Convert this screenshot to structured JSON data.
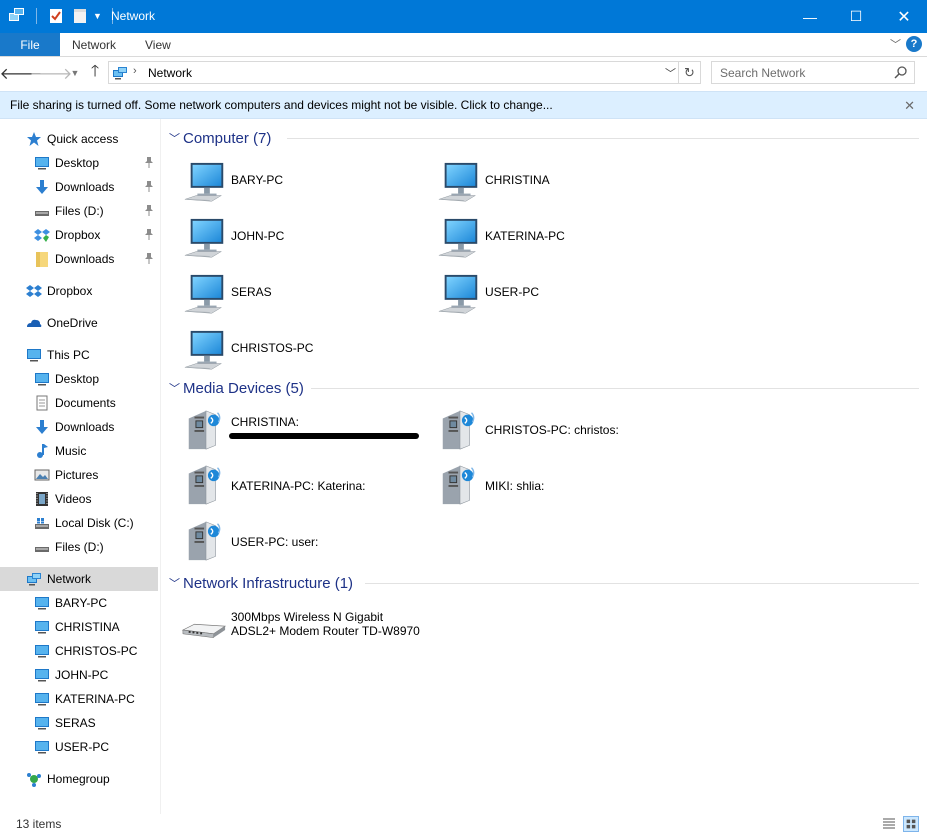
{
  "window": {
    "title": "Network",
    "accent": "#0078d7"
  },
  "ribbon": {
    "tabs": [
      "File",
      "Network",
      "View"
    ],
    "help_icon": "?"
  },
  "address": {
    "location": "Network",
    "search_placeholder": "Search Network"
  },
  "infobar": {
    "message": "File sharing is turned off. Some network computers and devices might not be visible. Click to change..."
  },
  "nav": {
    "quick_access": "Quick access",
    "qa_items": [
      {
        "label": "Desktop",
        "icon": "desktop-icon",
        "pinned": true
      },
      {
        "label": "Downloads",
        "icon": "downloads-icon",
        "pinned": true
      },
      {
        "label": "Files (D:)",
        "icon": "drive-icon",
        "pinned": true
      },
      {
        "label": "Dropbox",
        "icon": "dropbox-icon",
        "pinned": true
      },
      {
        "label": "Downloads",
        "icon": "folder-icon",
        "pinned": true
      }
    ],
    "dropbox": "Dropbox",
    "onedrive": "OneDrive",
    "this_pc": "This PC",
    "pc_items": [
      {
        "label": "Desktop",
        "icon": "desktop-icon"
      },
      {
        "label": "Documents",
        "icon": "documents-icon"
      },
      {
        "label": "Downloads",
        "icon": "downloads-icon"
      },
      {
        "label": "Music",
        "icon": "music-icon"
      },
      {
        "label": "Pictures",
        "icon": "pictures-icon"
      },
      {
        "label": "Videos",
        "icon": "videos-icon"
      },
      {
        "label": "Local Disk (C:)",
        "icon": "windows-drive-icon"
      },
      {
        "label": "Files (D:)",
        "icon": "drive-icon"
      }
    ],
    "network": "Network",
    "network_items": [
      "BARY-PC",
      "CHRISTINA",
      "CHRISTOS-PC",
      "JOHN-PC",
      "KATERINA-PC",
      "SERAS",
      "USER-PC"
    ],
    "homegroup": "Homegroup"
  },
  "groups": {
    "computer": {
      "title": "Computer (7)",
      "items": [
        "BARY-PC",
        "CHRISTINA",
        "JOHN-PC",
        "KATERINA-PC",
        "SERAS",
        "USER-PC",
        "CHRISTOS-PC"
      ]
    },
    "media": {
      "title": "Media Devices (5)",
      "items": [
        "CHRISTINA:",
        "CHRISTOS-PC: christos:",
        "KATERINA-PC: Katerina:",
        "MIKI: shlia:",
        "USER-PC: user:"
      ]
    },
    "infra": {
      "title": "Network Infrastructure (1)",
      "router_line1": "300Mbps Wireless N Gigabit",
      "router_line2": "ADSL2+ Modem Router TD-W8970"
    }
  },
  "status": {
    "count": "13 items"
  }
}
